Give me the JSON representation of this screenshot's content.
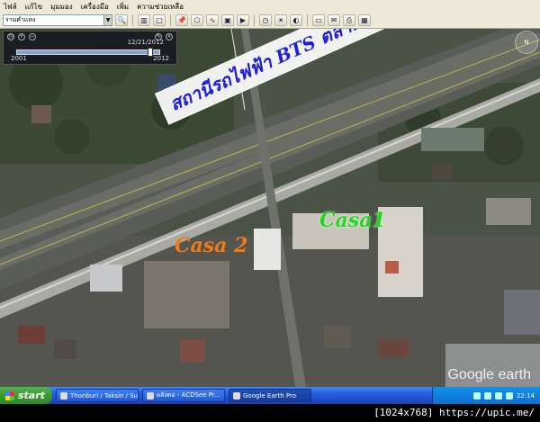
{
  "menu": {
    "items": [
      "ไฟล์",
      "แก้ไข",
      "มุมมอง",
      "เครื่องมือ",
      "เพิ่ม",
      "ความช่วยเหลือ"
    ]
  },
  "toolbar": {
    "search_value": "รามคำแหง",
    "buttons": [
      "search-icon",
      "sidebar-icon",
      "placemark-icon",
      "polygon-icon",
      "path-icon",
      "image-overlay-icon",
      "tour-icon",
      "history-icon",
      "sun-icon",
      "planets-icon",
      "ruler-icon",
      "email-icon",
      "print-icon",
      "view-maps-icon"
    ]
  },
  "timeslider": {
    "end_date": "12/21/2012",
    "start_year": "2001",
    "end_year": "2012"
  },
  "map": {
    "station_label": "สถานีรถไฟฟ้า BTS ตลาดพลู",
    "casa1_label": "Casa1",
    "casa2_label": "Casa 2",
    "compass": "N",
    "logo": "Google earth"
  },
  "taskbar": {
    "start_label": "start",
    "tasks": [
      "Thonburi / Taksin / Su...",
      "ผลังดอ - ACDSee Pr...",
      "Google Earth Pro"
    ],
    "language": "EN",
    "clock": "22:14"
  },
  "footer": {
    "caption": "[1024x768] https://upic.me/"
  },
  "colors": {
    "station_text": "#1d1dd6",
    "casa1": "#22d622",
    "casa2": "#ee7a18",
    "taskbar": "#245edb",
    "start": "#3b9a33"
  }
}
